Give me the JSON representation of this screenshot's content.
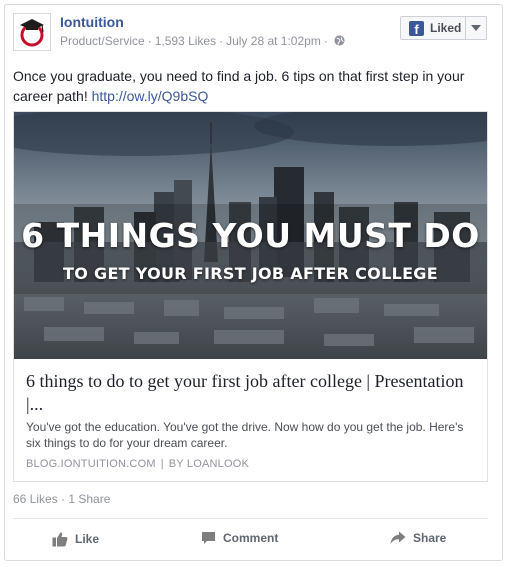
{
  "page": {
    "name": "Iontuition",
    "category": "Product/Service",
    "likes": "1,593 Likes",
    "date": "July 28 at 1:02pm"
  },
  "like_button": {
    "label": "Liked"
  },
  "post": {
    "text": "Once you graduate, you need to find a job. 6 tips on that first step in your career path!",
    "link": "http://ow.ly/Q9bSQ"
  },
  "attachment": {
    "image_headline": "6 THINGS YOU MUST DO",
    "image_subheadline": "TO GET YOUR FIRST JOB AFTER COLLEGE",
    "title": "6 things to do to get your first job after college | Presentation |...",
    "description": "You've got the education. You've got the drive. Now how do you get the job. Here's six things to do for your dream career.",
    "domain": "BLOG.IONTUITION.COM",
    "author": "BY LOANLOOK"
  },
  "stats": {
    "likes": "66 Likes",
    "shares": "1 Share"
  },
  "actions": {
    "like": "Like",
    "comment": "Comment",
    "share": "Share"
  },
  "colors": {
    "brand": "#3b5998",
    "muted": "#90949c",
    "logo_red": "#c8102e"
  }
}
